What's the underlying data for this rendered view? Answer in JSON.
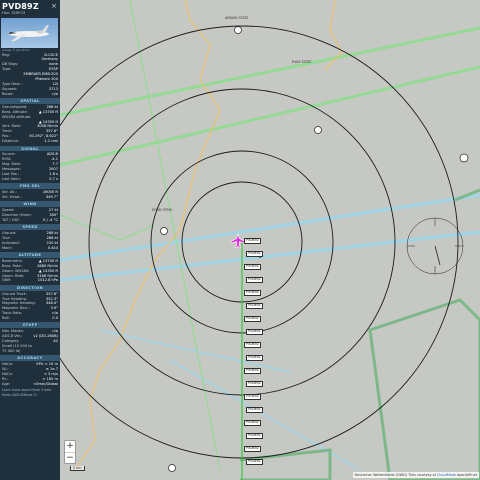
{
  "sidebar": {
    "callsign": "PVD89Z",
    "hex_line": "Hex: 3C6FC9",
    "close_icon": "close-icon",
    "photo_credit": "Image © Jan Dirks",
    "info": [
      {
        "k": "Reg:",
        "v": "D-CSCE"
      },
      {
        "k": "",
        "v": "Germany"
      },
      {
        "k": "DB flags:",
        "v": "none"
      },
      {
        "k": "Type:",
        "v": "E55P"
      },
      {
        "k": "",
        "v": "EMBRAER EMB-505"
      },
      {
        "k": "",
        "v": "Phenom 300"
      },
      {
        "k": "Type Desc.:",
        "v": "L2J"
      },
      {
        "k": "Squawk:",
        "v": "3713"
      },
      {
        "k": "Route:",
        "v": "n/a"
      }
    ],
    "sections": [
      {
        "title": "SPATIAL",
        "rows": [
          {
            "k": "Groundspeed:",
            "v": "288 kt"
          },
          {
            "k": "Baro. Altitude:",
            "v": "▲ 13700 ft"
          },
          {
            "k": "WGS84 altitude:",
            "v": ""
          },
          {
            "k": "",
            "v": "▲ 14350 ft"
          },
          {
            "k": "Vert. Rate:",
            "v": "3008 ft/min"
          },
          {
            "k": "Track:",
            "v": "357.6°"
          },
          {
            "k": "Pos.:",
            "v": "50.292°, 8.622°"
          },
          {
            "k": "Distance:",
            "v": "1.2 nmi"
          }
        ]
      },
      {
        "title": "SIGNAL",
        "rows": [
          {
            "k": "Source:",
            "v": "ADS-B"
          },
          {
            "k": "RSSI:",
            "v": "-4.1"
          },
          {
            "k": "Msg. Rate:",
            "v": "7.7"
          },
          {
            "k": "Messages:",
            "v": "2007"
          },
          {
            "k": "Last Pos.:",
            "v": "1.8 s"
          },
          {
            "k": "Last Seen:",
            "v": "0.7 s"
          }
        ]
      },
      {
        "title": "FMS SEL",
        "rows": [
          {
            "k": "Sel. Alt.:",
            "v": "16000 ft"
          },
          {
            "k": "Sel. Head.:",
            "v": "349.7°"
          }
        ]
      },
      {
        "title": "WIND",
        "rows": [
          {
            "k": "Speed:",
            "v": "27 kt"
          },
          {
            "k": "Direction (from):",
            "v": "300°"
          },
          {
            "k": "TAT / OAT:",
            "v": "0 / -4 °C"
          }
        ]
      },
      {
        "title": "SPEED",
        "rows": [
          {
            "k": "Ground:",
            "v": "288 kt"
          },
          {
            "k": "True:",
            "v": "286 kt"
          },
          {
            "k": "Indicated:",
            "v": "220 kt"
          },
          {
            "k": "Mach:",
            "v": "0.444"
          }
        ]
      },
      {
        "title": "ALTITUDE",
        "rows": [
          {
            "k": "Barometric:",
            "v": "▲ 13700 ft"
          },
          {
            "k": "Baro. Rate:",
            "v": "2880 ft/min"
          },
          {
            "k": "Geom. WGS84:",
            "v": "▲ 14350 ft"
          },
          {
            "k": "Geom. Rate:",
            "v": "3168 ft/min"
          },
          {
            "k": "QNH:",
            "v": "1012.8 hPa"
          }
        ]
      },
      {
        "title": "DIRECTION",
        "rows": [
          {
            "k": "Ground Track:",
            "v": "357.6°"
          },
          {
            "k": "True Heading:",
            "v": "352.3°"
          },
          {
            "k": "Magnetic Heading:",
            "v": "348.4°"
          },
          {
            "k": "Magnetic Decl.:",
            "v": "3.9°"
          },
          {
            "k": "Track Rate:",
            "v": "n/a"
          },
          {
            "k": "Roll:",
            "v": "0.0"
          }
        ]
      },
      {
        "title": "STUFF",
        "rows": [
          {
            "k": "Nav. Modes:",
            "v": "n/a"
          },
          {
            "k": "ADS-B Ver.:",
            "v": "v2 (DO-260B)"
          },
          {
            "k": "Category:",
            "v": "A2"
          },
          {
            "k": "Small (15 500 to",
            "v": ""
          },
          {
            "k": "75 000 lb)",
            "v": ""
          }
        ]
      },
      {
        "title": "ACCURACY",
        "rows": [
          {
            "k": "NACp:",
            "v": "EPU < 10 m"
          },
          {
            "k": "SIL:",
            "v": "≤ 1e-7"
          },
          {
            "k": "NACv:",
            "v": "< 3 m/s"
          },
          {
            "k": "Rc:",
            "v": "< 185 m"
          },
          {
            "k": "Age:",
            "v": "<5min/Global"
          }
        ]
      }
    ],
    "learn_more": "Learn more about Mode S data fields (ADS-B/Mode S)"
  },
  "map": {
    "zoom_in": "+",
    "zoom_out": "−",
    "scale_label": "5 km",
    "attribution_prefix": "Deutscher Wetterdienst (DWD) Tiles courtesy of",
    "attribution_link": "CloudMade",
    "attribution_suffix": "openAIP.net",
    "colors": {
      "range_ring": "#1b1b1b",
      "airway": "#8fdc8f",
      "route": "#a0d4e8",
      "track": "#39c63f",
      "border": "#f0c060",
      "aircraft": "#e02de0"
    },
    "labels": [
      {
        "text": "AIRWAY STATE"
      },
      {
        "text": "EHRD GTMS"
      },
      {
        "text": "EVAS STATE"
      }
    ],
    "aircraft_tags": [
      {
        "text": "PVD89Z"
      },
      {
        "text": "PVD89Z"
      },
      {
        "text": "PVD89Z"
      },
      {
        "text": "PVD89Z"
      },
      {
        "text": "PVD89Z"
      },
      {
        "text": "PVD89Z"
      },
      {
        "text": "PVD89Z"
      },
      {
        "text": "PVD89Z"
      },
      {
        "text": "PVD89Z"
      },
      {
        "text": "PVD89Z"
      },
      {
        "text": "PVD89Z"
      },
      {
        "text": "PVD89Z"
      },
      {
        "text": "PVD89Z"
      },
      {
        "text": "PVD89Z"
      },
      {
        "text": "PVD89Z"
      },
      {
        "text": "PVD89Z"
      },
      {
        "text": "PVD89Z"
      },
      {
        "text": "PVD89Z"
      }
    ]
  }
}
